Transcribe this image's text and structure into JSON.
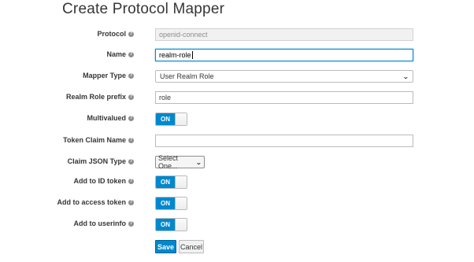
{
  "page": {
    "title": "Create Protocol Mapper"
  },
  "form": {
    "protocol": {
      "label": "Protocol",
      "value": "openid-connect",
      "readonly": true
    },
    "name": {
      "label": "Name",
      "value": "realm-role"
    },
    "mapper_type": {
      "label": "Mapper Type",
      "value": "User Realm Role"
    },
    "realm_role_prefix": {
      "label": "Realm Role prefix",
      "value": "role"
    },
    "multivalued": {
      "label": "Multivalued",
      "state": "ON"
    },
    "token_claim_name": {
      "label": "Token Claim Name",
      "value": ""
    },
    "claim_json_type": {
      "label": "Claim JSON Type",
      "value": "Select One..."
    },
    "add_to_id_token": {
      "label": "Add to ID token",
      "state": "ON"
    },
    "add_to_access_token": {
      "label": "Add to access token",
      "state": "ON"
    },
    "add_to_userinfo": {
      "label": "Add to userinfo",
      "state": "ON"
    }
  },
  "actions": {
    "save_label": "Save",
    "cancel_label": "Cancel"
  },
  "icons": {
    "help": "question-circle-icon",
    "dropdown": "chevron-down-icon"
  },
  "colors": {
    "primary": "#0088ce",
    "text": "#363636"
  }
}
